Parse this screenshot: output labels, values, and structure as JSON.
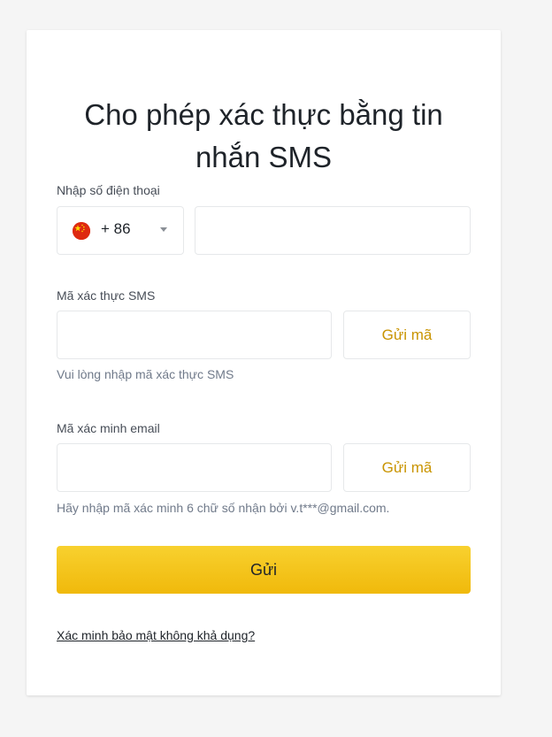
{
  "title": {
    "line1": "Cho phép xác thực bằng tin",
    "line2": "nhắn SMS"
  },
  "phone": {
    "label": "Nhập số điện thoại",
    "country_code": "+ 86",
    "flag_icon": "china-flag-icon",
    "value": "",
    "placeholder": ""
  },
  "sms": {
    "label": "Mã xác thực SMS",
    "value": "",
    "placeholder": "",
    "send_label": "Gửi mã",
    "hint": "Vui lòng nhập mã xác thực SMS"
  },
  "email": {
    "label": "Mã xác minh email",
    "value": "",
    "placeholder": "",
    "send_label": "Gửi mã",
    "hint": "Hãy nhập mã xác minh 6 chữ số nhận bởi v.t***@gmail.com."
  },
  "submit_label": "Gửi",
  "unavailable_link": "Xác minh bảo mật không khả dụng?",
  "colors": {
    "accent": "#F0B90B",
    "send_text": "#C99400",
    "text": "#1E2329",
    "muted": "#707A8A",
    "border": "#E6E8EA",
    "background": "#F5F5F5"
  }
}
